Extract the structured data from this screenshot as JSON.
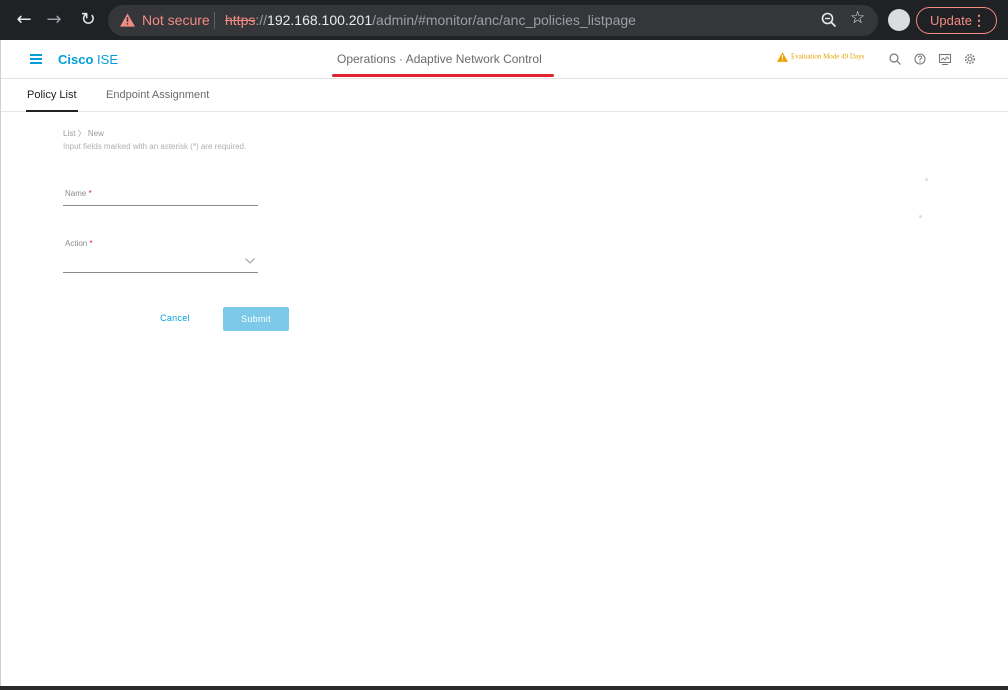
{
  "browser": {
    "security_label": "Not secure",
    "url_scheme": "https",
    "url_separator": "://",
    "url_host": "192.168.100.201",
    "url_path": "/admin/#monitor/anc/anc_policies_listpage",
    "update_label": "Update",
    "menu_glyph": "⋮"
  },
  "header": {
    "brand_bold": "Cisco",
    "brand_light": "ISE",
    "title": "Operations · Adaptive Network Control",
    "eval_badge": "Evaluation Mode 49 Days",
    "accent_color": "#049fd9",
    "underline_color": "#e0232e",
    "icons": [
      "search-icon",
      "help-icon",
      "notifications-icon",
      "settings-icon"
    ]
  },
  "tabs": [
    {
      "label": "Policy List",
      "active": true
    },
    {
      "label": "Endpoint Assignment",
      "active": false
    }
  ],
  "form": {
    "breadcrumb_root": "List",
    "breadcrumb_sep": "〉",
    "breadcrumb_current": "New",
    "hint": "Input fields marked with an asterisk (*) are required.",
    "name_label": "Name",
    "action_label": "Action",
    "required_mark": "*",
    "name_value": "",
    "action_value": "",
    "cancel_label": "Cancel",
    "submit_label": "Submit",
    "submit_color": "#7cc9ea"
  }
}
